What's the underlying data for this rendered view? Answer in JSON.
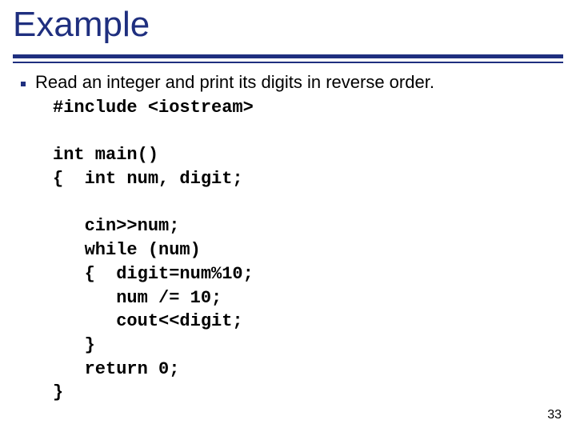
{
  "title": "Example",
  "bullet": "Read an integer and print its digits in reverse order.",
  "code": "#include <iostream>\n\nint main()\n{  int num, digit;\n\n   cin>>num;\n   while (num)\n   {  digit=num%10;\n      num /= 10;\n      cout<<digit;\n   }\n   return 0;\n}",
  "page_number": "33"
}
